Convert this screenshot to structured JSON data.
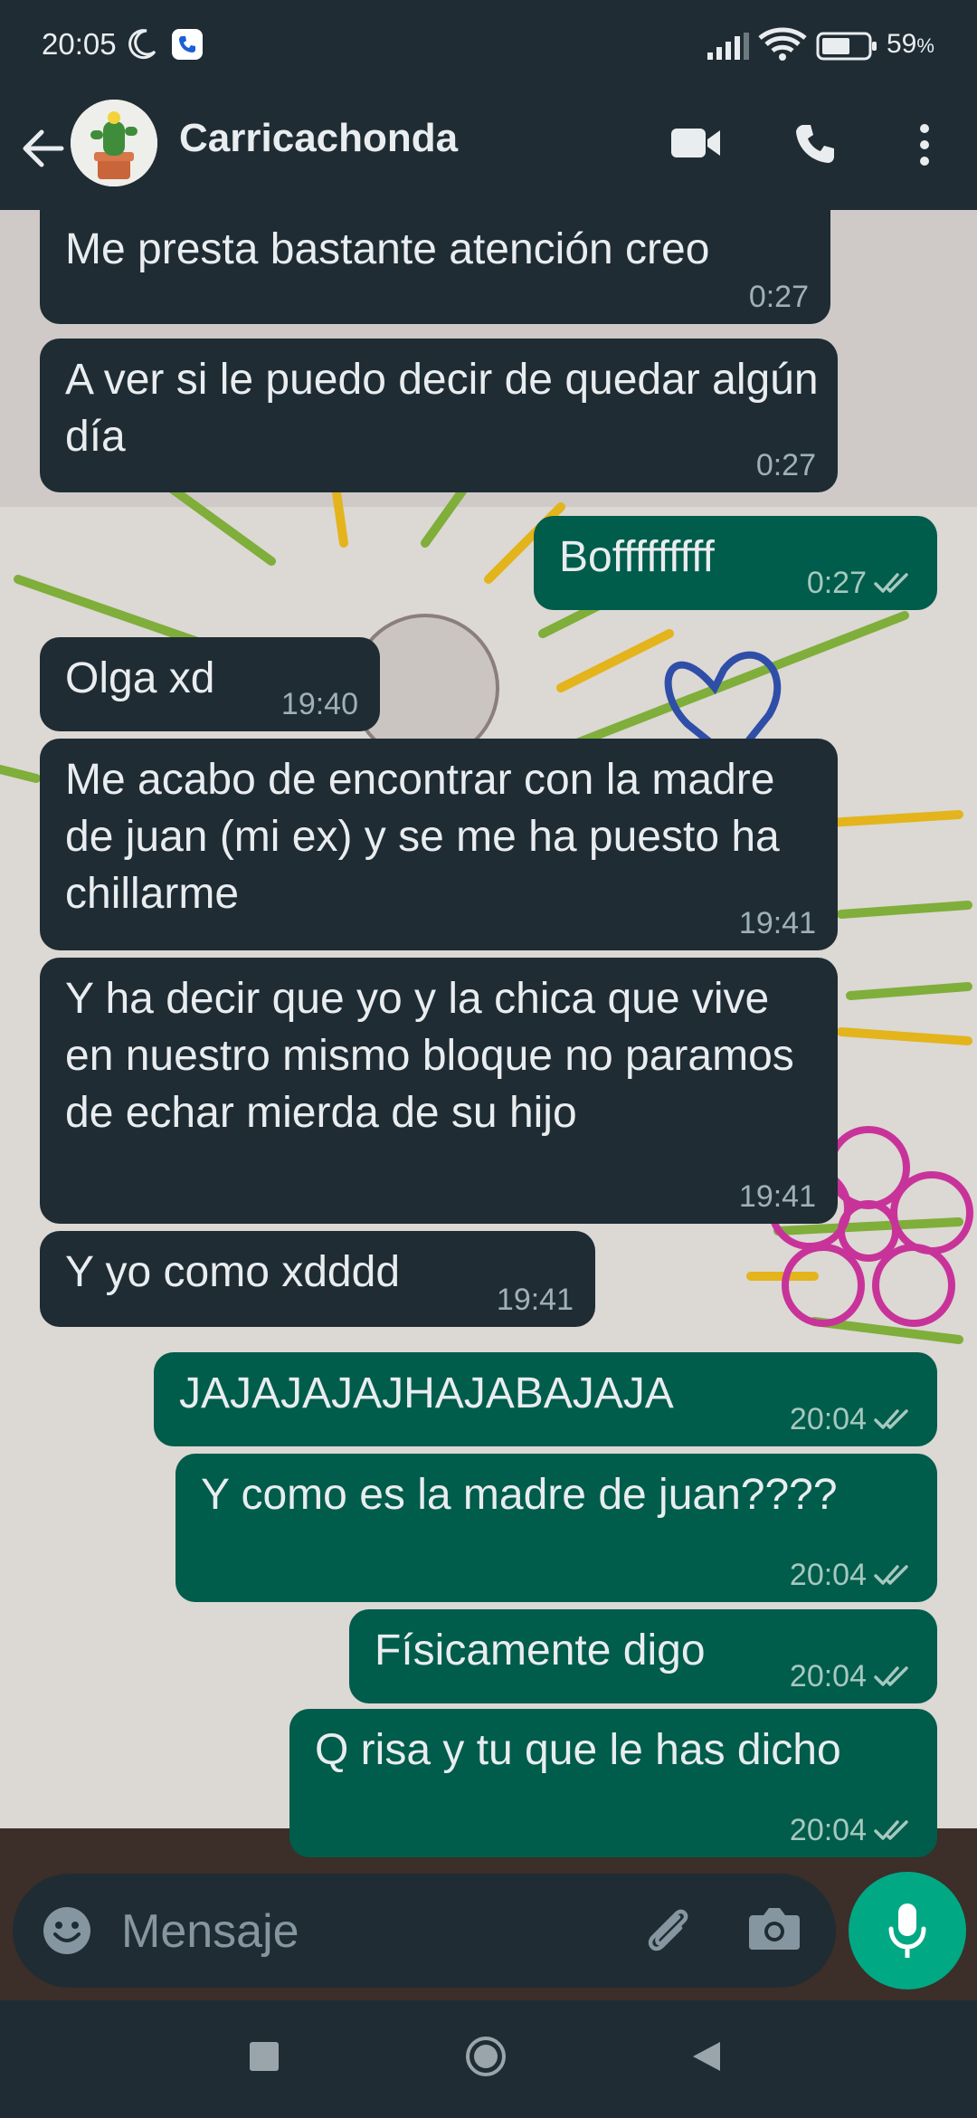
{
  "status_bar": {
    "time": "20:05",
    "battery_percent": "59",
    "battery_unit": "%",
    "icons": [
      "moon-icon",
      "whatsapp-call-icon",
      "signal-icon",
      "wifi-icon",
      "battery-icon"
    ]
  },
  "header": {
    "contact_name": "Carricachonda",
    "icons": [
      "back-arrow-icon",
      "video-call-icon",
      "voice-call-icon",
      "more-options-icon"
    ]
  },
  "messages": [
    {
      "direction": "in",
      "text": "Me presta bastante atención creo",
      "time": "0:27"
    },
    {
      "direction": "in",
      "text": "A ver si le puedo decir de quedar algún día",
      "time": "0:27"
    },
    {
      "direction": "out",
      "text": "Bofffffffff",
      "time": "0:27",
      "read": true
    },
    {
      "direction": "in",
      "text": "Olga xd",
      "time": "19:40"
    },
    {
      "direction": "in",
      "text": "Me acabo de encontrar con la madre de juan (mi ex) y se me ha puesto ha chillarme",
      "time": "19:41"
    },
    {
      "direction": "in",
      "text": "Y ha decir que yo y la chica que vive en nuestro mismo bloque no paramos de echar mierda de su hijo",
      "time": "19:41"
    },
    {
      "direction": "in",
      "text": "Y yo como xdddd",
      "time": "19:41"
    },
    {
      "direction": "out",
      "text": "JAJAJAJAJHAJABAJAJA",
      "time": "20:04",
      "read": true
    },
    {
      "direction": "out",
      "text": "Y como es la madre de juan????",
      "time": "20:04",
      "read": true
    },
    {
      "direction": "out",
      "text": "Físicamente digo",
      "time": "20:04",
      "read": true
    },
    {
      "direction": "out",
      "text": "Q risa y tu que le has dicho",
      "time": "20:04",
      "read": true
    }
  ],
  "input": {
    "placeholder": "Mensaje",
    "icons": [
      "emoji-icon",
      "attach-icon",
      "camera-icon",
      "mic-icon"
    ]
  },
  "colors": {
    "bar_bg": "#1f2c34",
    "incoming_bubble": "#1f2c34",
    "outgoing_bubble": "#005c4b",
    "accent": "#00a884",
    "read_ticks": "#a6c8bf"
  }
}
